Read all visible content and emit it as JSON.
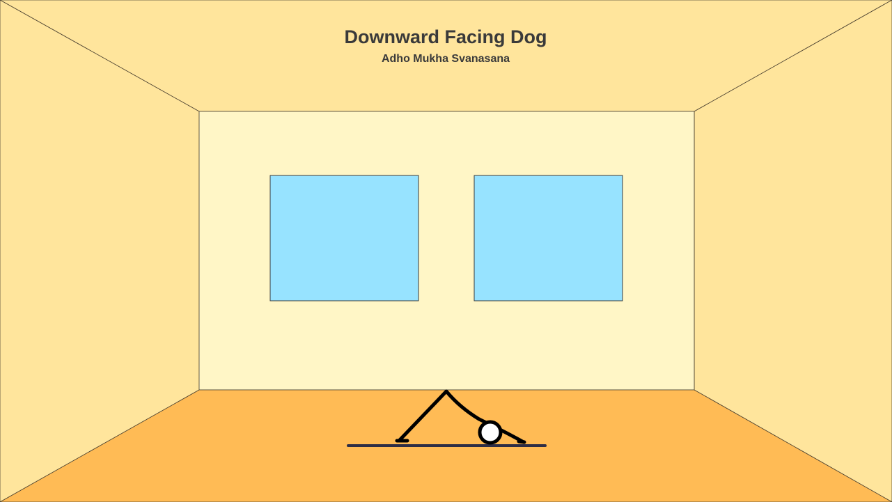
{
  "pose": {
    "title": "Downward Facing Dog",
    "subtitle": "Adho Mukha Svanasana"
  },
  "colors": {
    "ceiling": "#ffe59c",
    "side_walls": "#ffe59c",
    "back_wall": "#fff6c6",
    "floor": "#ffbb55",
    "windows": "#97e3ff",
    "mat": "#2e2d45",
    "figure_stroke": "#000000",
    "head_fill": "#ffffff",
    "edges": "#4a4030",
    "title_text": "#3a3a3a"
  }
}
